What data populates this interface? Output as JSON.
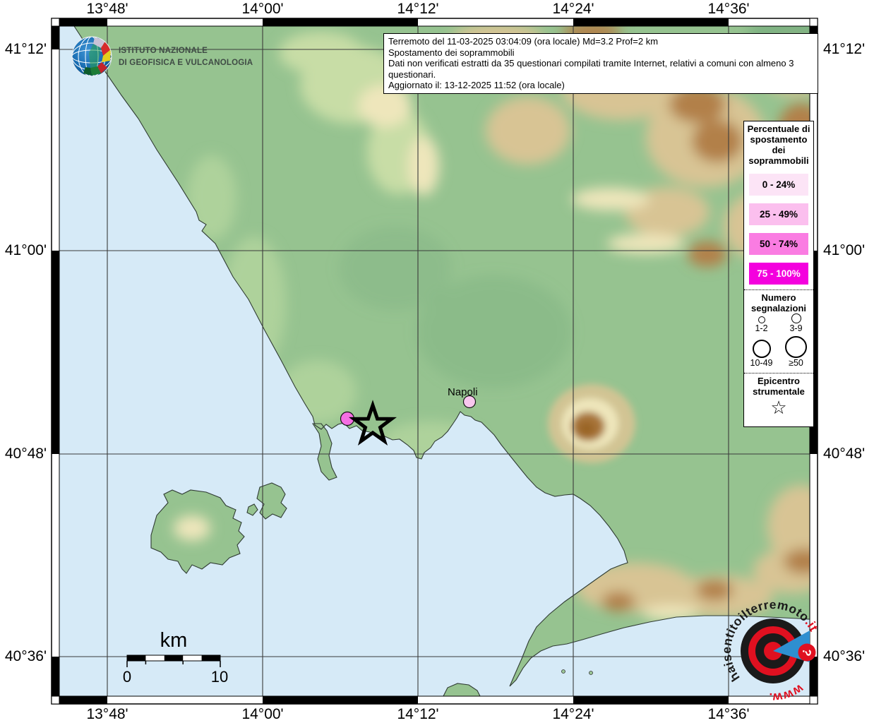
{
  "info_box": {
    "lines": [
      "Terremoto del 11-03-2025 03:04:09 (ora locale) Md=3.2 Prof=2 km",
      "Spostamento dei soprammobili",
      "Dati non verificati estratti da 35 questionari compilati tramite Internet, relativi a comuni con almeno 3 questionari.",
      "Aggiornato il: 13-12-2025 11:52 (ora locale)"
    ]
  },
  "axes": {
    "top": [
      "13°48'",
      "14°00'",
      "14°12'",
      "14°24'",
      "14°36'"
    ],
    "bottom": [
      "13°48'",
      "14°00'",
      "14°12'",
      "14°24'",
      "14°36'"
    ],
    "left": [
      "41°12'",
      "41°00'",
      "40°48'",
      "40°36'"
    ],
    "right": [
      "41°12'",
      "41°00'",
      "40°48'",
      "40°36'"
    ]
  },
  "legend": {
    "percent_title": "Percentuale di spostamento dei soprammobili",
    "percent_classes": [
      {
        "label": "0 - 24%",
        "color": "#fce4f6",
        "text": "#000000"
      },
      {
        "label": "25 - 49%",
        "color": "#fbbfee",
        "text": "#000000"
      },
      {
        "label": "50 - 74%",
        "color": "#fa7ce2",
        "text": "#000000"
      },
      {
        "label": "75 - 100%",
        "color": "#f400de",
        "text": "#ffffff"
      }
    ],
    "reports_title": "Numero segnalazioni",
    "report_classes": [
      "1-2",
      "3-9",
      "10-49",
      "≥50"
    ],
    "epicenter_title": "Epicentro strumentale",
    "epicenter_star": "☆"
  },
  "map": {
    "city": {
      "name": "Napoli",
      "dot_color": "#f8c7ee"
    },
    "report_dot_color": "#f56fe3",
    "sea_color": "#d6eaf7",
    "land_color": "#96c390",
    "scalebar": {
      "unit": "km",
      "start": "0",
      "end": "10"
    }
  },
  "logos": {
    "ingv": {
      "line1": "ISTITUTO NAZIONALE",
      "line2": "DI GEOFISICA E VULCANOLOGIA"
    },
    "site": {
      "arc_main": "haisentito",
      "arc_mid": "ilterremoto",
      "arc_suffix": ".it",
      "arc_www": "www.",
      "badge": "?"
    }
  }
}
